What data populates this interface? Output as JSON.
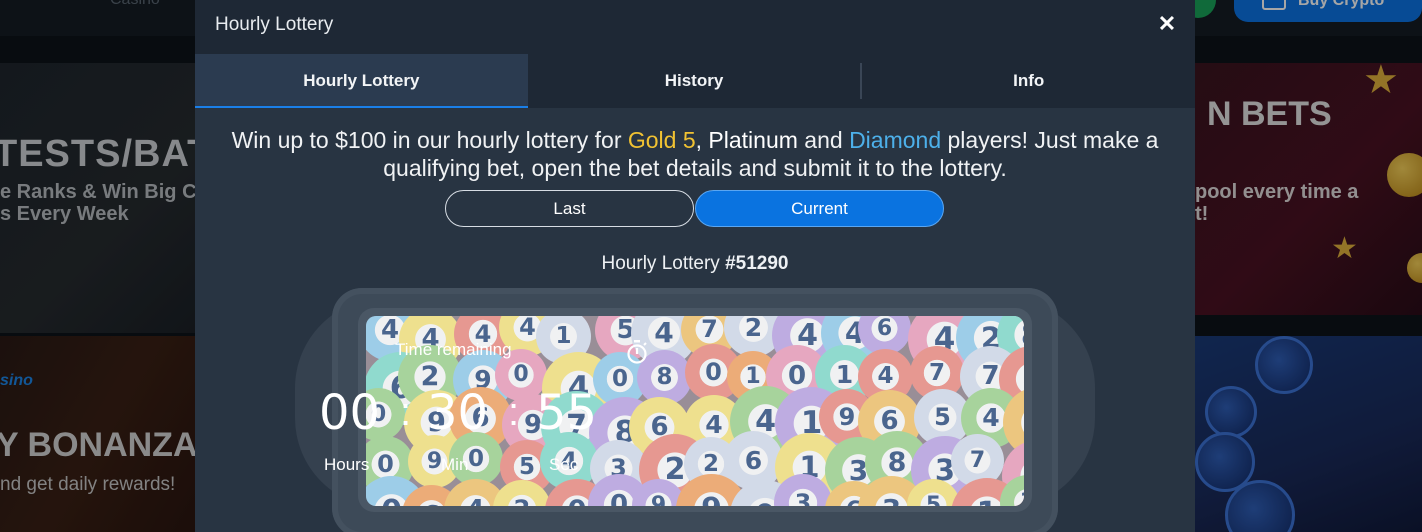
{
  "background": {
    "nav_casino": "Casino",
    "buy_crypto": "Buy Crypto",
    "left_top": {
      "title": "TESTS/BATT",
      "line1": "e Ranks & Win Big Ca",
      "line2": "s Every Week"
    },
    "left_bottom": {
      "tag": "sino",
      "title": "Y BONANZA",
      "line1": "nd get daily rewards!"
    },
    "right_top": {
      "title": "N BETS",
      "line1": "pool every time a",
      "line2": "t!"
    }
  },
  "modal": {
    "title": "Hourly Lottery",
    "close_icon": "close-icon",
    "tabs": [
      {
        "label": "Hourly Lottery",
        "active": true
      },
      {
        "label": "History",
        "active": false
      },
      {
        "label": "Info",
        "active": false
      }
    ],
    "promo": {
      "part1": "Win up to $100 in our hourly lottery for ",
      "gold": "Gold 5",
      "part2": ", ",
      "platinum": "Platinum",
      "part3": " and ",
      "diamond": "Diamond",
      "part4": " players! Just make a",
      "line2": "qualifying bet, open the bet details and submit it to the lottery."
    },
    "segment": {
      "last": "Last",
      "current": "Current",
      "selected": "Current"
    },
    "lottery_label": "Hourly Lottery",
    "lottery_number": "#51290",
    "timer": {
      "label": "Time remaining",
      "hours": "00",
      "minutes": "30",
      "seconds": "55",
      "separator": ":",
      "hours_label": "Hours",
      "minutes_label": "Min",
      "seconds_label": "Sec"
    }
  },
  "colors": {
    "accent": "#0a73e0",
    "gold": "#f1c232",
    "diamond": "#4db0ea",
    "modal_bg": "#283442",
    "header_bg": "#1e2835"
  }
}
